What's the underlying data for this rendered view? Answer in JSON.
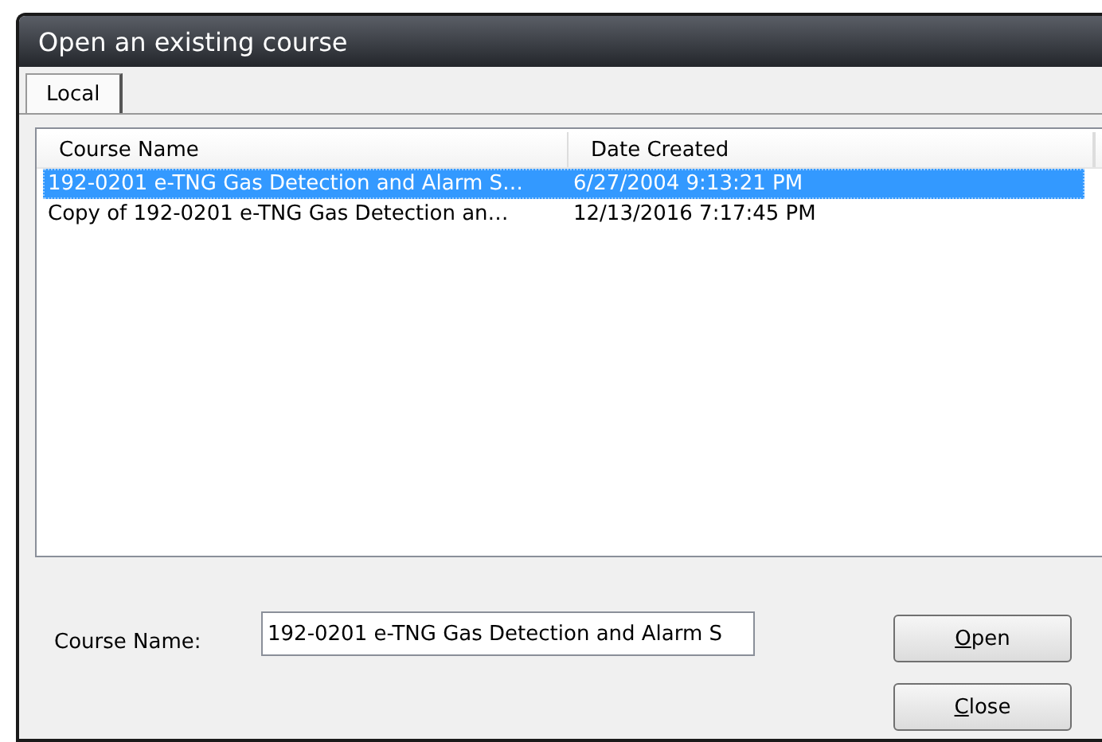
{
  "window": {
    "title": "Open an existing course"
  },
  "tabs": [
    {
      "label": "Local",
      "selected": true
    }
  ],
  "table": {
    "columns": [
      "Course Name",
      "Date Created"
    ],
    "rows": [
      {
        "cells": [
          "192-0201 e-TNG Gas Detection and Alarm S…",
          "6/27/2004 9:13:21 PM"
        ],
        "selected": true
      },
      {
        "cells": [
          "Copy of 192-0201 e-TNG Gas Detection an…",
          "12/13/2016 7:17:45 PM"
        ],
        "selected": false
      }
    ]
  },
  "course_name": {
    "label": "Course Name:",
    "value": "192-0201 e-TNG Gas Detection and Alarm S"
  },
  "buttons": [
    {
      "label": "Open",
      "access_key_underlined": true
    },
    {
      "label": "Close",
      "access_key_underlined": true
    }
  ]
}
